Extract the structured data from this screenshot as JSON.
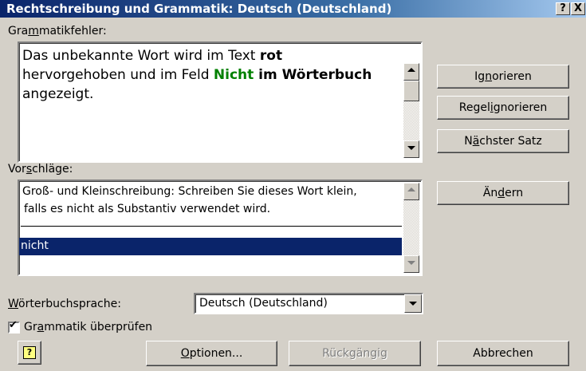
{
  "window": {
    "title": "Rechtschreibung und Grammatik: Deutsch (Deutschland)",
    "help_button": "?",
    "close_button": "X"
  },
  "error_section": {
    "label_pre": "Gra",
    "label_u": "m",
    "label_post": "matikfehler:",
    "text": {
      "part1": "Das unbekannte Wort wird im Text ",
      "part1_bold": "rot",
      "part2": "hervorgehoben und im Feld ",
      "part2_green": "Nicht",
      "part2_bold": " im Wörterbuch",
      "part3": "angezeigt."
    }
  },
  "suggestions": {
    "label_pre": "Vor",
    "label_u": "s",
    "label_post": "chläge:",
    "hint_line1": "Groß- und Kleinschreibung: Schreiben Sie dieses Wort klein,",
    "hint_line2": "falls es nicht als Substantiv verwendet wird.",
    "items": [
      "nicht"
    ]
  },
  "buttons": {
    "ignore": {
      "pre": "Ig",
      "u": "n",
      "post": "orieren"
    },
    "ignore_rule": {
      "pre": "Regel ",
      "u": "i",
      "post": "gnorieren"
    },
    "next_sentence": {
      "pre": "N",
      "u": "ä",
      "post": "chster Satz"
    },
    "change": {
      "pre": "Än",
      "u": "d",
      "post": "ern"
    },
    "options": {
      "pre": "",
      "u": "O",
      "post": "ptionen..."
    },
    "undo": "Rückgängig",
    "cancel": "Abbrechen",
    "assistant": "?"
  },
  "dictionary": {
    "label_pre": "",
    "label_u": "W",
    "label_post": "örterbuchsprache:",
    "selected": "Deutsch (Deutschland)"
  },
  "grammar_check": {
    "label_pre": "Gr",
    "label_u": "a",
    "label_post": "mmatik überprüfen",
    "checked": true,
    "checkmark": "✔"
  }
}
